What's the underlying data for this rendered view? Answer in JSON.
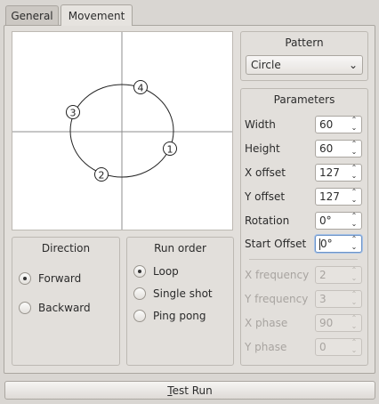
{
  "tabs": [
    "General",
    "Movement"
  ],
  "canvas": {
    "markers": [
      "1",
      "2",
      "3",
      "4"
    ]
  },
  "pattern": {
    "title": "Pattern",
    "selected": "Circle"
  },
  "parameters": {
    "title": "Parameters",
    "rows": [
      {
        "label": "Width",
        "value": "60"
      },
      {
        "label": "Height",
        "value": "60"
      },
      {
        "label": "X offset",
        "value": "127"
      },
      {
        "label": "Y offset",
        "value": "127"
      },
      {
        "label": "Rotation",
        "value": "0°"
      },
      {
        "label": "Start Offset",
        "value": "0°"
      }
    ],
    "disabled_rows": [
      {
        "label": "X frequency",
        "value": "2"
      },
      {
        "label": "Y frequency",
        "value": "3"
      },
      {
        "label": "X phase",
        "value": "90"
      },
      {
        "label": "Y phase",
        "value": "0"
      }
    ]
  },
  "direction": {
    "title": "Direction",
    "options": [
      "Forward",
      "Backward"
    ],
    "selected": "Forward"
  },
  "run_order": {
    "title": "Run order",
    "options": [
      "Loop",
      "Single shot",
      "Ping pong"
    ],
    "selected": "Loop"
  },
  "test_run_button": {
    "label_prefix": "T",
    "label_rest": "est Run"
  }
}
